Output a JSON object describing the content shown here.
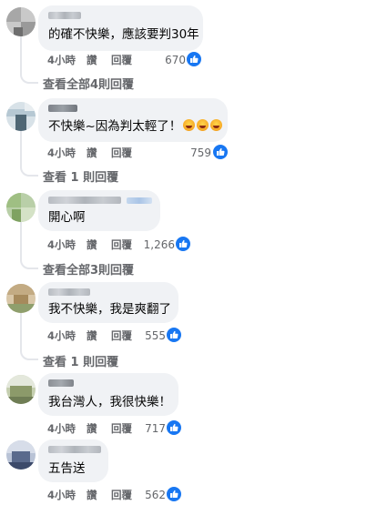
{
  "comments": [
    {
      "text": "的確不快樂，應該要判30年",
      "time": "4小時",
      "like": "讚",
      "reply": "回覆",
      "count": "670",
      "more": "查看全部4則回覆"
    },
    {
      "text": "不快樂~因為判太輕了！",
      "emojis": 3,
      "time": "4小時",
      "like": "讚",
      "reply": "回覆",
      "count": "759",
      "more": "查看 1 則回覆"
    },
    {
      "text": "開心啊",
      "time": "4小時",
      "like": "讚",
      "reply": "回覆",
      "count": "1,266",
      "more": "查看全部3則回覆"
    },
    {
      "text": "我不快樂，我是爽翻了",
      "time": "4小時",
      "like": "讚",
      "reply": "回覆",
      "count": "555",
      "more": "查看 1 則回覆"
    },
    {
      "text": "我台灣人，我很快樂！",
      "time": "4小時",
      "like": "讚",
      "reply": "回覆",
      "count": "717"
    },
    {
      "text": "五告送",
      "time": "4小時",
      "like": "讚",
      "reply": "回覆",
      "count": "562"
    }
  ],
  "icons": {
    "reaction": "thumbs-up-icon",
    "avatar": "blurred-avatar"
  },
  "colors": {
    "bubble": "#f0f2f5",
    "meta": "#65676b",
    "like_blue": "#1877f2"
  }
}
